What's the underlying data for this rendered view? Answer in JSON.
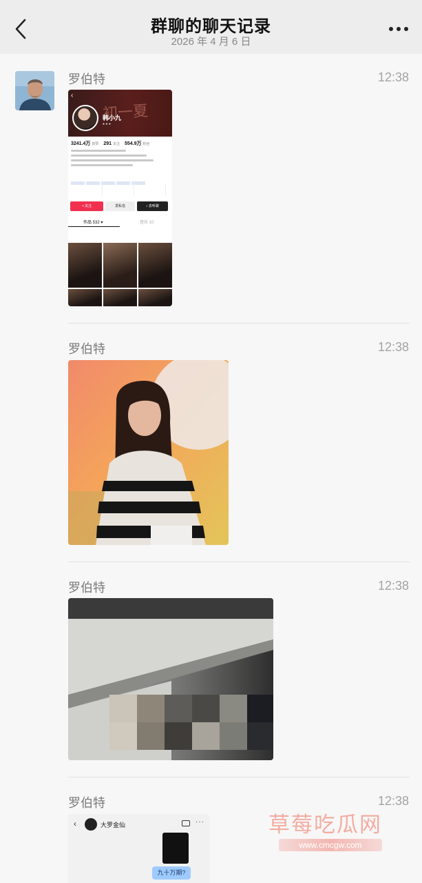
{
  "header": {
    "title": "群聊的聊天记录",
    "date": "2026 年 4 月 6 日"
  },
  "messages": [
    {
      "sender": "罗伯特",
      "time": "12:38",
      "content": "image-profile-screenshot"
    },
    {
      "sender": "罗伯特",
      "time": "12:38",
      "content": "image-portrait"
    },
    {
      "sender": "罗伯特",
      "time": "12:38",
      "content": "image-blurred-photo"
    },
    {
      "sender": "罗伯特",
      "time": "12:38",
      "content": "image-chat-screenshot"
    }
  ],
  "profile_shot": {
    "name": "韩小九",
    "stat1": "3241.4万",
    "stat2": "291",
    "stat3": "554.9万",
    "tab_works": "作品 532 ▾",
    "tab_music": "音乐 10"
  },
  "chat_shot": {
    "contact": "大罗金仙",
    "bubble": "九十万期?"
  },
  "watermark": {
    "text": "草莓吃瓜网",
    "url": "www.cmcgw.com"
  },
  "colors": {
    "header_bg": "#ededed",
    "page_bg": "#f7f7f7",
    "sender_text": "#7b7b7b",
    "time_text": "#a3a3a3"
  }
}
